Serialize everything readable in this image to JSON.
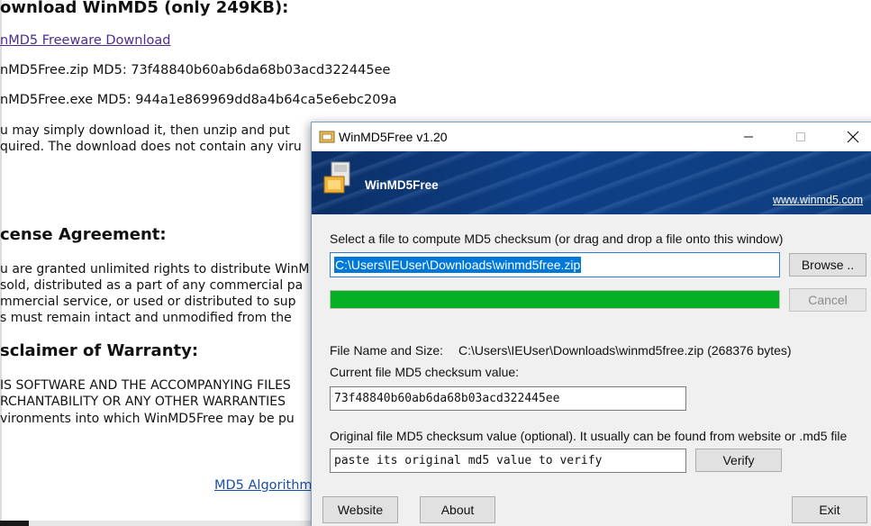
{
  "page": {
    "heading_download": "ownload WinMD5 (only 249KB):",
    "download_link": "nMD5 Freeware Download",
    "zip_md5_line": "nMD5Free.zip MD5: 73f48840b60ab6da68b03acd322445ee",
    "exe_md5_line": "nMD5Free.exe MD5: 944a1e869969dd8a4b64ca5e6ebc209a",
    "desc_line1": "u may simply download it, then unzip and put",
    "desc_line2": "quired. The download does not contain any viru",
    "heading_license": "cense Agreement:",
    "license_line1": "u are granted unlimited rights to distribute WinM",
    "license_line2": "sold, distributed as a part of any commercial pa",
    "license_line3": "mmercial service, or used or distributed to sup",
    "license_line4": "s must remain intact and unmodified from the",
    "heading_disclaimer": "sclaimer of Warranty:",
    "disclaimer_line1": "IS SOFTWARE AND THE ACCOMPANYING FILES",
    "disclaimer_line2": "RCHANTABILITY OR ANY OTHER WARRANTIES",
    "disclaimer_line3": "vironments into which WinMD5Free may be pu",
    "md5_algorithm_link": "MD5 Algorithm"
  },
  "window": {
    "title": "WinMD5Free v1.20",
    "banner_name": "WinMD5Free",
    "banner_site": "www.winmd5.com",
    "select_label": "Select a file to compute MD5 checksum (or drag and drop a file onto this window)",
    "file_path_value": "C:\\Users\\IEUser\\Downloads\\winmd5free.zip",
    "browse_label": "Browse ..",
    "cancel_label": "Cancel",
    "progress_fraction": 1.0,
    "file_name_size_label": "File Name and Size:",
    "file_name_size_value": "C:\\Users\\IEUser\\Downloads\\winmd5free.zip (268376 bytes)",
    "current_md5_label": "Current file MD5 checksum value:",
    "current_md5_value": "73f48840b60ab6da68b03acd322445ee",
    "original_md5_label": "Original file MD5 checksum value (optional). It usually can be found from website or .md5 file",
    "original_md5_placeholder": "paste its original md5 value to verify",
    "verify_label": "Verify",
    "website_label": "Website",
    "about_label": "About",
    "exit_label": "Exit"
  },
  "colors": {
    "progress_fill": "#06b025",
    "selection": "#0078d7",
    "banner": "#0e3f86",
    "link_visited": "#4b2c91"
  },
  "icons": {
    "app": "winmd5-app-icon",
    "minimize": "minimize-icon",
    "maximize": "maximize-icon",
    "close": "close-icon",
    "banner_logo": "winmd5-logo-icon"
  }
}
